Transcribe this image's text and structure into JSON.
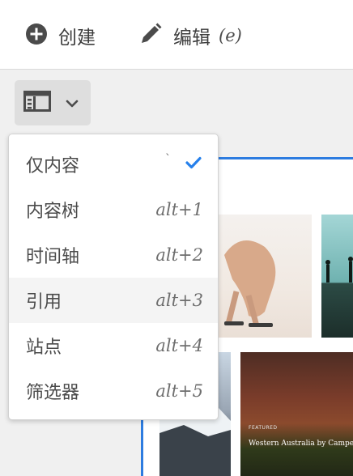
{
  "toolbar": {
    "create_label": "创建",
    "edit_label": "编辑",
    "edit_shortcut": "(e)"
  },
  "rail_toggle": {
    "icon": "rail-layout-icon",
    "chevron": "chevron-down-icon"
  },
  "menu": {
    "items": [
      {
        "label": "仅内容",
        "shortcut": "",
        "selected": true,
        "backtick": "`"
      },
      {
        "label": "内容树",
        "shortcut": "alt+1",
        "selected": false
      },
      {
        "label": "时间轴",
        "shortcut": "alt+2",
        "selected": false
      },
      {
        "label": "引用",
        "shortcut": "alt+3",
        "selected": false,
        "hovered": true
      },
      {
        "label": "站点",
        "shortcut": "alt+4",
        "selected": false
      },
      {
        "label": "筛选器",
        "shortcut": "alt+5",
        "selected": false
      }
    ]
  },
  "content": {
    "featured_card": {
      "tag": "FEATURED",
      "title": "Western Australia by Camper Van"
    }
  },
  "colors": {
    "accent": "#2d7ce0",
    "check": "#2680eb",
    "toolbar_bg": "#ffffff",
    "page_bg": "#f0f0f0"
  }
}
